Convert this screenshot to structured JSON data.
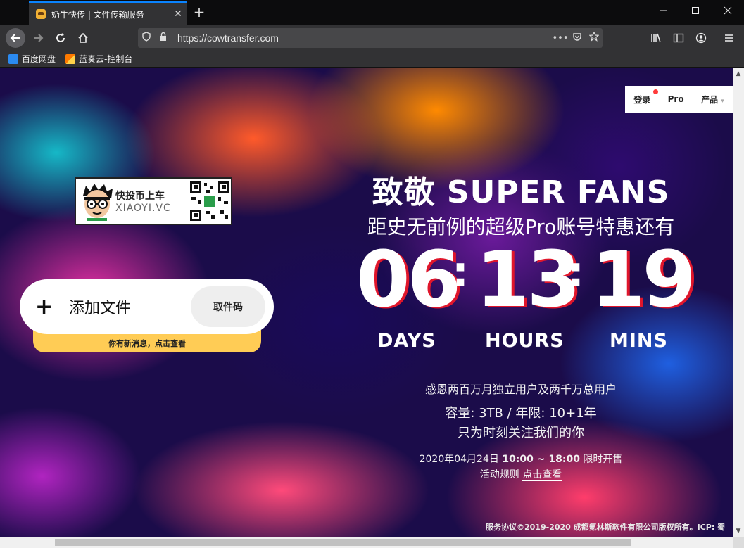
{
  "browser": {
    "tab_title": "奶牛快传 | 文件传输服务",
    "tab_close": "✕",
    "new_tab": "+",
    "url": "https://cowtransfer.com",
    "page_actions": "•••",
    "bookmarks": [
      {
        "label": "百度网盘"
      },
      {
        "label": "蓝奏云-控制台"
      }
    ]
  },
  "nav": {
    "login": "登录",
    "pro": "Pro",
    "products": "产品"
  },
  "promo": {
    "line1": "快投币上车",
    "line2": "XIAOYI.VC"
  },
  "upload": {
    "plus": "+",
    "add_file": "添加文件",
    "pickup_code": "取件码",
    "notice": "你有新消息，点击查看"
  },
  "hero": {
    "line1": "致敬 SUPER FANS",
    "line2": "距史无前例的超级Pro账号特惠还有",
    "countdown": {
      "days": "06",
      "hours": "13",
      "mins": "19",
      "separator": ":"
    },
    "units": {
      "days": "DAYS",
      "hours": "HOURS",
      "mins": "MINS"
    },
    "thanks": "感恩两百万月独立用户及两千万总用户",
    "capacity": "容量: 3TB / 年限: 10+1年",
    "tagline": "只为时刻关注我们的你",
    "sale_date": "2020年04月24日",
    "sale_time": "10:00 ~ 18:00",
    "sale_suffix": "限时开售",
    "rules_label": "活动规则",
    "rules_link": "点击查看"
  },
  "footer": {
    "text": "服务协议©2019-2020 成都氪林斯软件有限公司版权所有。ICP: 蜀"
  },
  "colors": {
    "accent_red": "#e0162b",
    "notice_yellow": "#ffcc55",
    "tab_highlight": "#0a84ff"
  }
}
